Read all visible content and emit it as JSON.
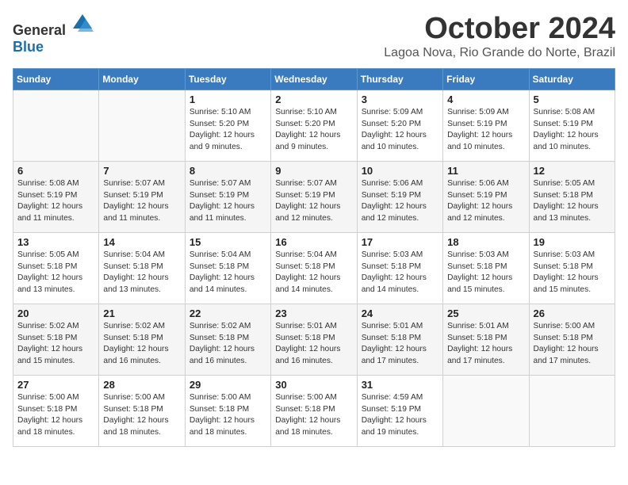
{
  "logo": {
    "general": "General",
    "blue": "Blue"
  },
  "title": "October 2024",
  "location": "Lagoa Nova, Rio Grande do Norte, Brazil",
  "days_header": [
    "Sunday",
    "Monday",
    "Tuesday",
    "Wednesday",
    "Thursday",
    "Friday",
    "Saturday"
  ],
  "weeks": [
    [
      {
        "day": "",
        "content": ""
      },
      {
        "day": "",
        "content": ""
      },
      {
        "day": "1",
        "content": "Sunrise: 5:10 AM\nSunset: 5:20 PM\nDaylight: 12 hours and 9 minutes."
      },
      {
        "day": "2",
        "content": "Sunrise: 5:10 AM\nSunset: 5:20 PM\nDaylight: 12 hours and 9 minutes."
      },
      {
        "day": "3",
        "content": "Sunrise: 5:09 AM\nSunset: 5:20 PM\nDaylight: 12 hours and 10 minutes."
      },
      {
        "day": "4",
        "content": "Sunrise: 5:09 AM\nSunset: 5:19 PM\nDaylight: 12 hours and 10 minutes."
      },
      {
        "day": "5",
        "content": "Sunrise: 5:08 AM\nSunset: 5:19 PM\nDaylight: 12 hours and 10 minutes."
      }
    ],
    [
      {
        "day": "6",
        "content": "Sunrise: 5:08 AM\nSunset: 5:19 PM\nDaylight: 12 hours and 11 minutes."
      },
      {
        "day": "7",
        "content": "Sunrise: 5:07 AM\nSunset: 5:19 PM\nDaylight: 12 hours and 11 minutes."
      },
      {
        "day": "8",
        "content": "Sunrise: 5:07 AM\nSunset: 5:19 PM\nDaylight: 12 hours and 11 minutes."
      },
      {
        "day": "9",
        "content": "Sunrise: 5:07 AM\nSunset: 5:19 PM\nDaylight: 12 hours and 12 minutes."
      },
      {
        "day": "10",
        "content": "Sunrise: 5:06 AM\nSunset: 5:19 PM\nDaylight: 12 hours and 12 minutes."
      },
      {
        "day": "11",
        "content": "Sunrise: 5:06 AM\nSunset: 5:19 PM\nDaylight: 12 hours and 12 minutes."
      },
      {
        "day": "12",
        "content": "Sunrise: 5:05 AM\nSunset: 5:18 PM\nDaylight: 12 hours and 13 minutes."
      }
    ],
    [
      {
        "day": "13",
        "content": "Sunrise: 5:05 AM\nSunset: 5:18 PM\nDaylight: 12 hours and 13 minutes."
      },
      {
        "day": "14",
        "content": "Sunrise: 5:04 AM\nSunset: 5:18 PM\nDaylight: 12 hours and 13 minutes."
      },
      {
        "day": "15",
        "content": "Sunrise: 5:04 AM\nSunset: 5:18 PM\nDaylight: 12 hours and 14 minutes."
      },
      {
        "day": "16",
        "content": "Sunrise: 5:04 AM\nSunset: 5:18 PM\nDaylight: 12 hours and 14 minutes."
      },
      {
        "day": "17",
        "content": "Sunrise: 5:03 AM\nSunset: 5:18 PM\nDaylight: 12 hours and 14 minutes."
      },
      {
        "day": "18",
        "content": "Sunrise: 5:03 AM\nSunset: 5:18 PM\nDaylight: 12 hours and 15 minutes."
      },
      {
        "day": "19",
        "content": "Sunrise: 5:03 AM\nSunset: 5:18 PM\nDaylight: 12 hours and 15 minutes."
      }
    ],
    [
      {
        "day": "20",
        "content": "Sunrise: 5:02 AM\nSunset: 5:18 PM\nDaylight: 12 hours and 15 minutes."
      },
      {
        "day": "21",
        "content": "Sunrise: 5:02 AM\nSunset: 5:18 PM\nDaylight: 12 hours and 16 minutes."
      },
      {
        "day": "22",
        "content": "Sunrise: 5:02 AM\nSunset: 5:18 PM\nDaylight: 12 hours and 16 minutes."
      },
      {
        "day": "23",
        "content": "Sunrise: 5:01 AM\nSunset: 5:18 PM\nDaylight: 12 hours and 16 minutes."
      },
      {
        "day": "24",
        "content": "Sunrise: 5:01 AM\nSunset: 5:18 PM\nDaylight: 12 hours and 17 minutes."
      },
      {
        "day": "25",
        "content": "Sunrise: 5:01 AM\nSunset: 5:18 PM\nDaylight: 12 hours and 17 minutes."
      },
      {
        "day": "26",
        "content": "Sunrise: 5:00 AM\nSunset: 5:18 PM\nDaylight: 12 hours and 17 minutes."
      }
    ],
    [
      {
        "day": "27",
        "content": "Sunrise: 5:00 AM\nSunset: 5:18 PM\nDaylight: 12 hours and 18 minutes."
      },
      {
        "day": "28",
        "content": "Sunrise: 5:00 AM\nSunset: 5:18 PM\nDaylight: 12 hours and 18 minutes."
      },
      {
        "day": "29",
        "content": "Sunrise: 5:00 AM\nSunset: 5:18 PM\nDaylight: 12 hours and 18 minutes."
      },
      {
        "day": "30",
        "content": "Sunrise: 5:00 AM\nSunset: 5:18 PM\nDaylight: 12 hours and 18 minutes."
      },
      {
        "day": "31",
        "content": "Sunrise: 4:59 AM\nSunset: 5:19 PM\nDaylight: 12 hours and 19 minutes."
      },
      {
        "day": "",
        "content": ""
      },
      {
        "day": "",
        "content": ""
      }
    ]
  ]
}
